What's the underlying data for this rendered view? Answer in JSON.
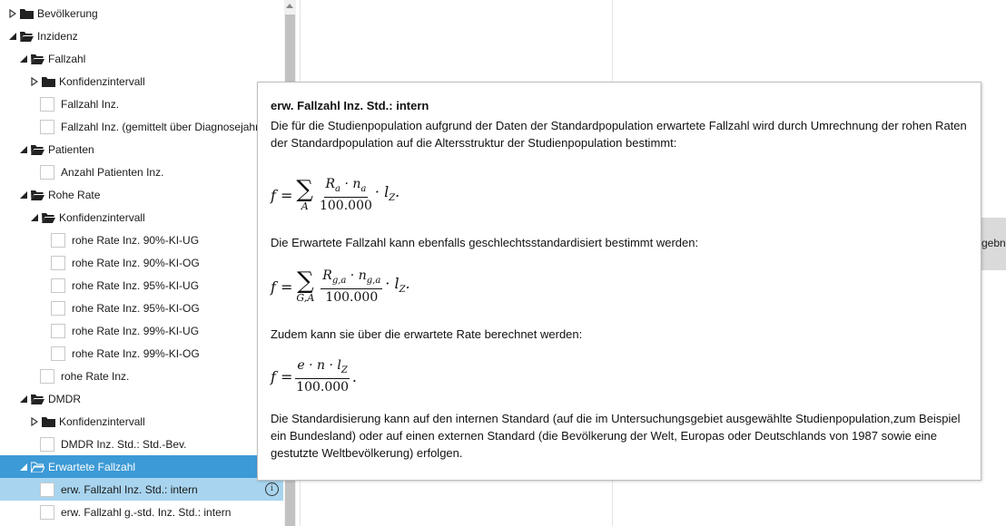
{
  "tree": {
    "rows": [
      {
        "label": "Bevölkerung",
        "expanded": false
      },
      {
        "label": "Inzidenz",
        "expanded": true
      },
      {
        "label": "Fallzahl",
        "expanded": true
      },
      {
        "label": "Konfidenzintervall",
        "expanded": false
      },
      {
        "label": "Fallzahl Inz."
      },
      {
        "label": "Fallzahl Inz. (gemittelt über Diagnosejahre)"
      },
      {
        "label": "Patienten",
        "expanded": true
      },
      {
        "label": "Anzahl Patienten Inz."
      },
      {
        "label": "Rohe Rate",
        "expanded": true
      },
      {
        "label": "Konfidenzintervall",
        "expanded": true
      },
      {
        "label": "rohe Rate Inz. 90%-KI-UG"
      },
      {
        "label": "rohe Rate Inz. 90%-KI-OG"
      },
      {
        "label": "rohe Rate Inz. 95%-KI-UG"
      },
      {
        "label": "rohe Rate Inz. 95%-KI-OG"
      },
      {
        "label": "rohe Rate Inz. 99%-KI-UG"
      },
      {
        "label": "rohe Rate Inz. 99%-KI-OG"
      },
      {
        "label": "rohe Rate Inz."
      },
      {
        "label": "DMDR",
        "expanded": true
      },
      {
        "label": "Konfidenzintervall",
        "expanded": false
      },
      {
        "label": "DMDR Inz. Std.: Std.-Bev."
      },
      {
        "label": "Erwartete Fallzahl",
        "expanded": true,
        "selected": true
      },
      {
        "label": "erw. Fallzahl Inz. Std.: intern",
        "hover": true
      },
      {
        "label": "erw. Fallzahl g.-std. Inz. Std.: intern"
      }
    ]
  },
  "info_icon": "info-icon",
  "result_button": {
    "label": "Ergebnis"
  },
  "tooltip": {
    "title": "erw. Fallzahl Inz. Std.: intern",
    "intro": "Die für die Studienpopulation aufgrund der Daten der Standardpopulation erwartete Fallzahl wird durch Umrechnung der rohen Raten der Standardpopulation auf die Altersstruktur der Studienpopulation bestimmt:",
    "formula1": {
      "lhs": "f =",
      "sub": "A",
      "num_a": "R",
      "num_a_sub": "a",
      "num_b": "n",
      "num_b_sub": "a",
      "den": "100.000",
      "tail": "· l",
      "tail_sub": "Z",
      "end": "."
    },
    "text2": "Die Erwartete Fallzahl kann ebenfalls geschlechtsstandardisiert bestimmt werden:",
    "formula2": {
      "lhs": "f =",
      "sub": "G,A",
      "num_a": "R",
      "num_a_sub": "g,a",
      "num_b": "n",
      "num_b_sub": "g,a",
      "den": "100.000",
      "tail": "· l",
      "tail_sub": "Z",
      "end": "."
    },
    "text3": "Zudem kann sie über die erwartete Rate berechnet werden:",
    "formula3": {
      "lhs": "f =",
      "num": "e · n · l",
      "num_sub": "Z",
      "den": "100.000",
      "end": "."
    },
    "text4": "Die Standardisierung kann auf den internen Standard (auf die im Untersuchungsgebiet ausgewählte Studienpopulation,zum Beispiel ein Bundesland) oder auf einen externen Standard (die Bevölkerung der Welt, Europas oder Deutschlands von 1987 sowie eine gestutzte Weltbevölkerung) erfolgen."
  }
}
